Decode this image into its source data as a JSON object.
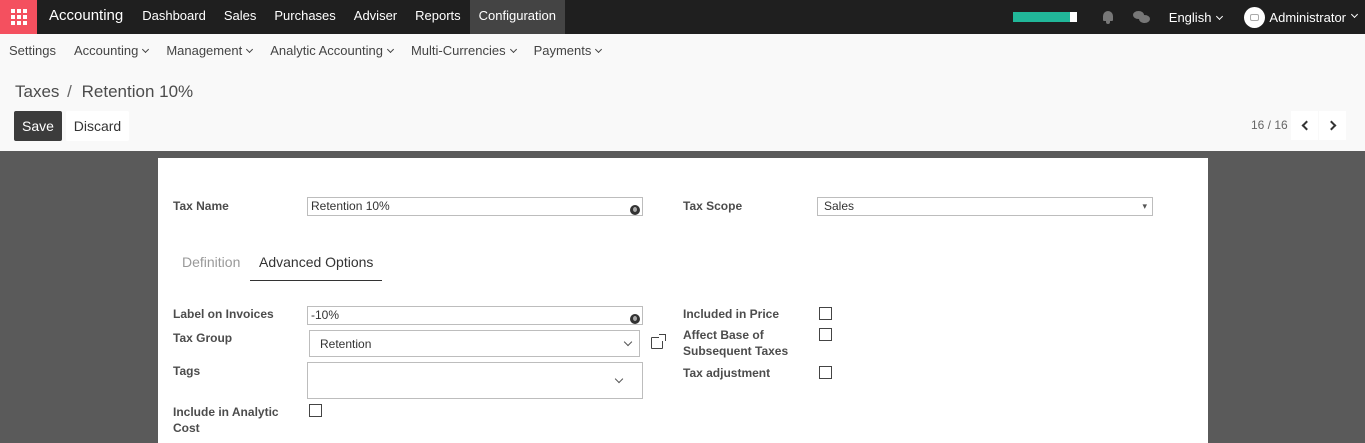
{
  "app": {
    "brand": "Accounting",
    "menu": [
      "Dashboard",
      "Sales",
      "Purchases",
      "Adviser",
      "Reports",
      "Configuration"
    ],
    "active_menu": "Configuration",
    "progress": 0.9,
    "progress_color": "#21b799",
    "language": "English",
    "user": "Administrator"
  },
  "submenu": [
    "Settings",
    "Accounting",
    "Management",
    "Analytic Accounting",
    "Multi-Currencies",
    "Payments"
  ],
  "breadcrumb": {
    "parent": "Taxes",
    "separator": "/",
    "current": "Retention 10%"
  },
  "actions": {
    "save": "Save",
    "discard": "Discard"
  },
  "pager": {
    "value": "16 / 16"
  },
  "form": {
    "tax_name": {
      "label": "Tax Name",
      "value": "Retention 10%"
    },
    "tax_scope": {
      "label": "Tax Scope",
      "value": "Sales"
    },
    "tabs": {
      "definition": "Definition",
      "advanced": "Advanced Options",
      "active": "Advanced Options"
    },
    "label_on_invoices": {
      "label": "Label on Invoices",
      "value": "-10%"
    },
    "tax_group": {
      "label": "Tax Group",
      "value": "Retention"
    },
    "tags": {
      "label": "Tags",
      "value": ""
    },
    "include_analytic": {
      "label": "Include in Analytic Cost",
      "checked": false
    },
    "included_in_price": {
      "label": "Included in Price",
      "checked": false
    },
    "affect_base": {
      "label": "Affect Base of Subsequent Taxes",
      "checked": false
    },
    "tax_adjustment": {
      "label": "Tax adjustment",
      "checked": false
    }
  },
  "colors": {
    "navbar": "#1f1f1f",
    "apps_button": "#f4505f",
    "save_button": "#3c3c3c"
  }
}
